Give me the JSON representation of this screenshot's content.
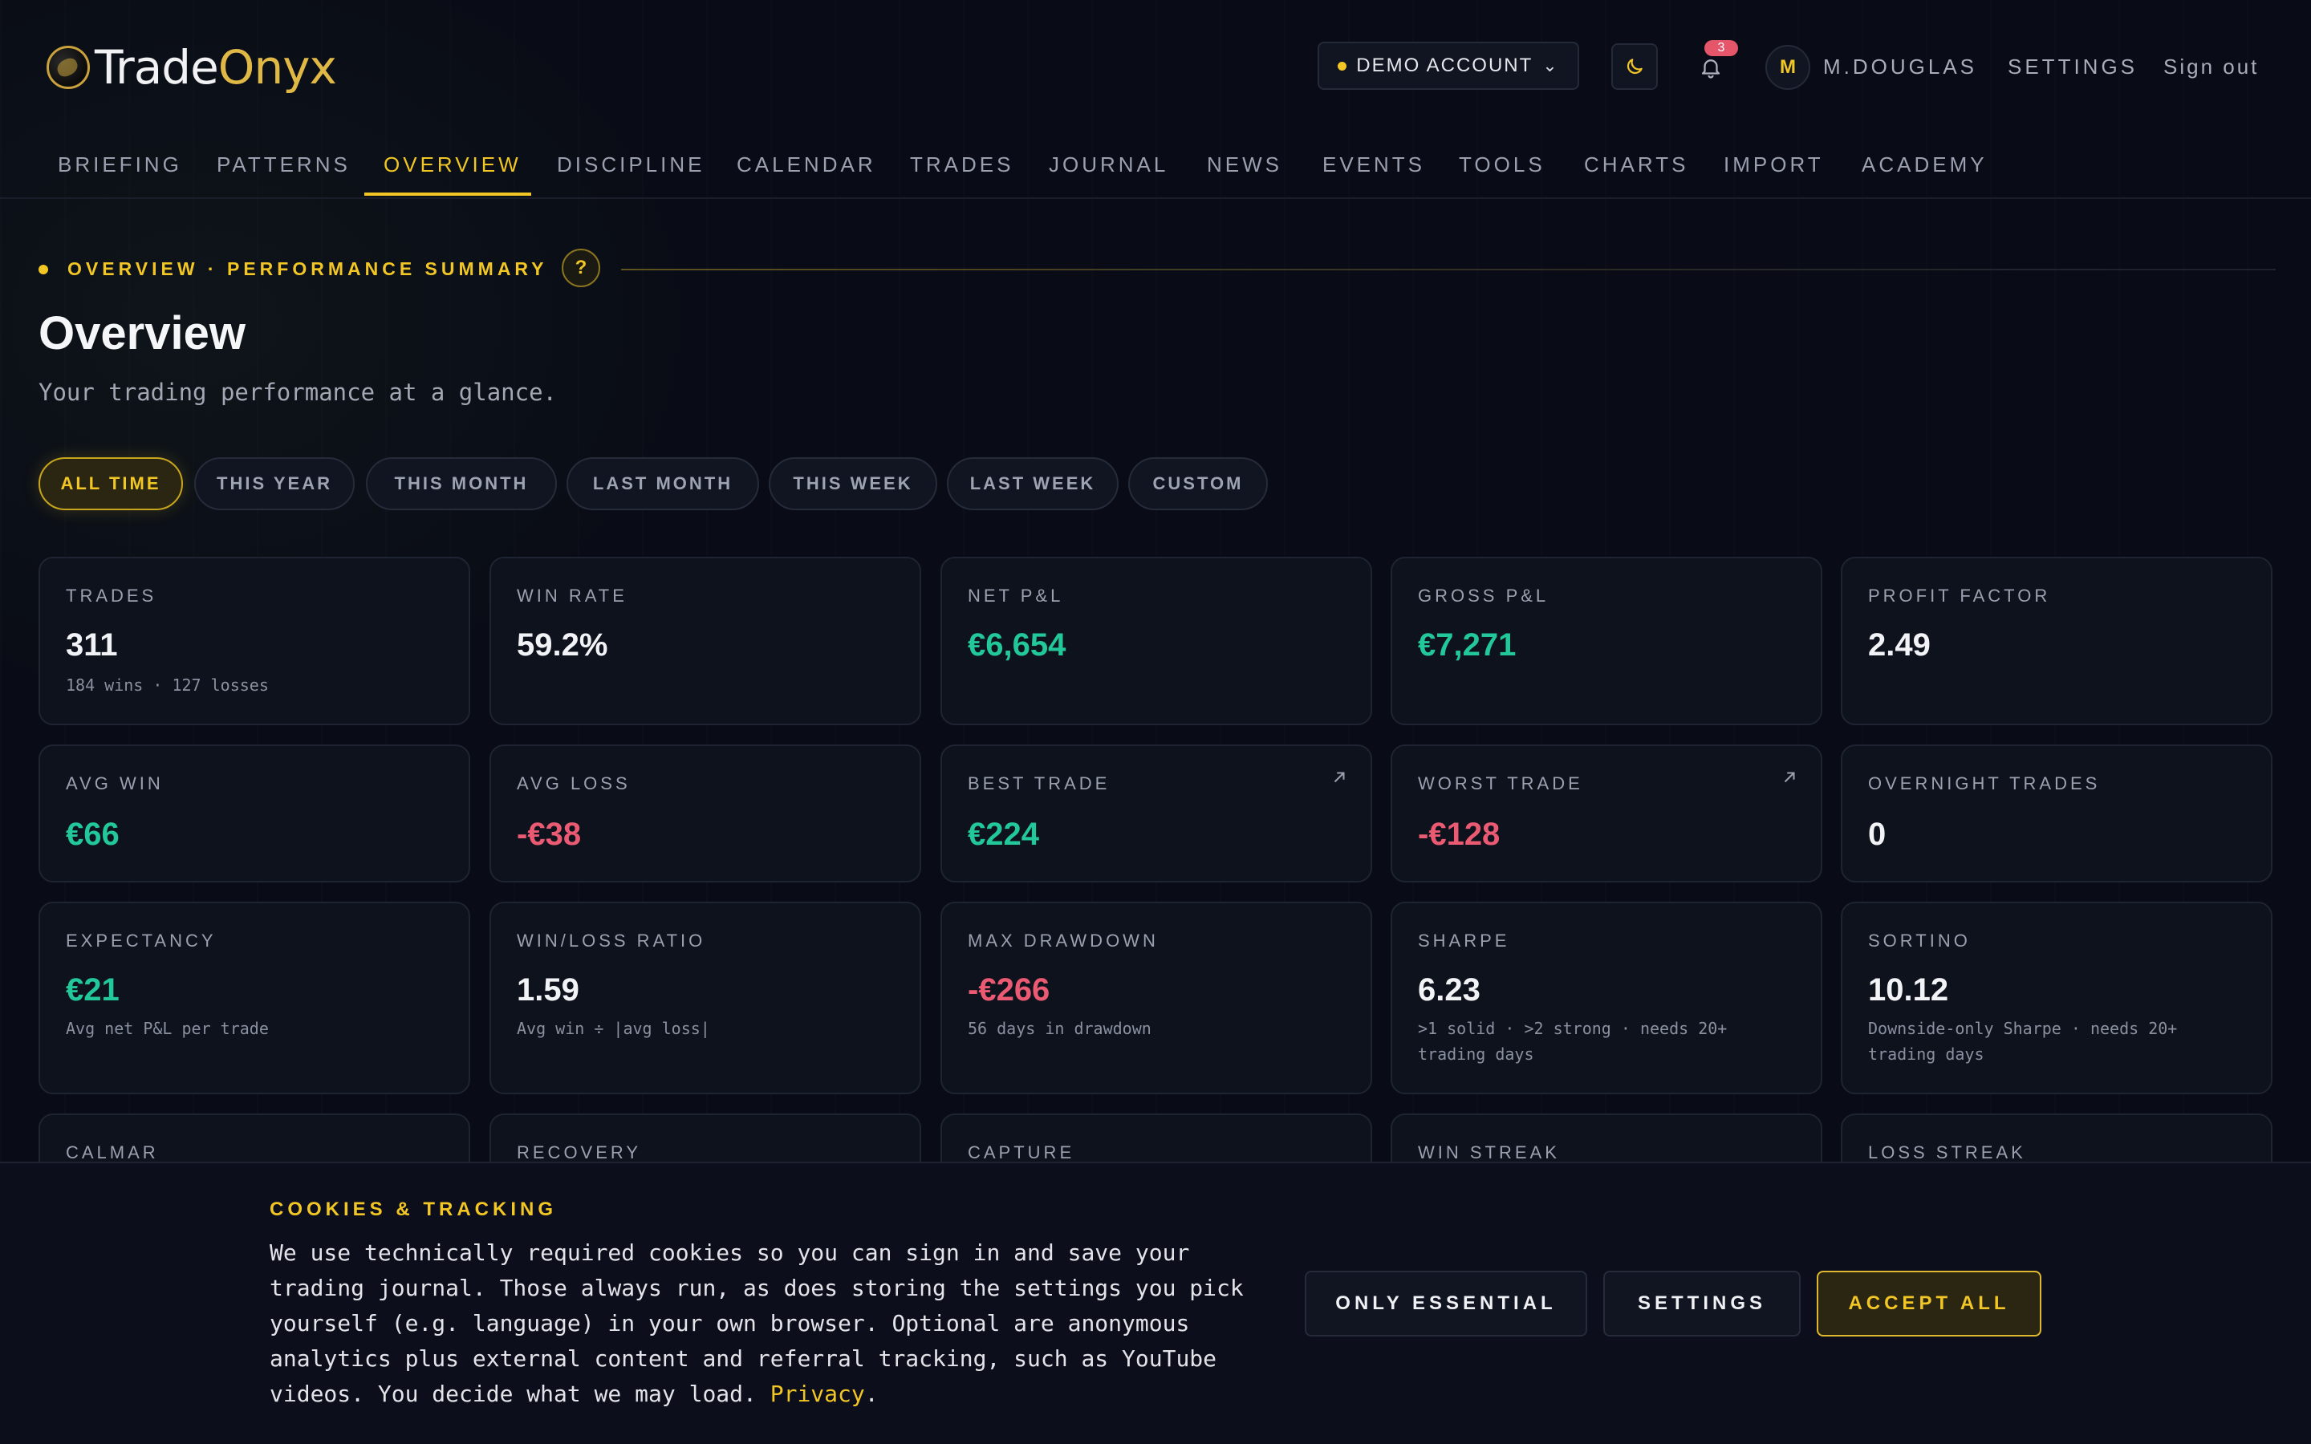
{
  "header": {
    "logo_part1": "Trade",
    "logo_part2": "Onyx",
    "account_label": "DEMO ACCOUNT",
    "notification_count": "3",
    "avatar_initial": "M",
    "username": "M.DOUGLAS",
    "settings_label": "SETTINGS",
    "signout_label": "Sign out"
  },
  "nav": {
    "items": [
      "BRIEFING",
      "PATTERNS",
      "OVERVIEW",
      "DISCIPLINE",
      "CALENDAR",
      "TRADES",
      "JOURNAL",
      "NEWS",
      "EVENTS",
      "TOOLS",
      "CHARTS",
      "IMPORT",
      "ACADEMY"
    ],
    "active": "OVERVIEW"
  },
  "section": {
    "eyebrow": "OVERVIEW · PERFORMANCE SUMMARY",
    "help": "?",
    "title": "Overview",
    "subtitle": "Your trading performance at a glance."
  },
  "filters": {
    "items": [
      "ALL TIME",
      "THIS YEAR",
      "THIS MONTH",
      "LAST MONTH",
      "THIS WEEK",
      "LAST WEEK",
      "CUSTOM"
    ],
    "active": "ALL TIME"
  },
  "cards": {
    "row1": [
      {
        "label": "TRADES",
        "value": "311",
        "note": "184 wins · 127 losses",
        "tone": "neutral"
      },
      {
        "label": "WIN RATE",
        "value": "59.2%",
        "note": "",
        "tone": "neutral"
      },
      {
        "label": "NET P&L",
        "value": "€6,654",
        "note": "",
        "tone": "pos"
      },
      {
        "label": "GROSS P&L",
        "value": "€7,271",
        "note": "",
        "tone": "pos"
      },
      {
        "label": "PROFIT FACTOR",
        "value": "2.49",
        "note": "",
        "tone": "neutral"
      }
    ],
    "row2": [
      {
        "label": "AVG WIN",
        "value": "€66",
        "tone": "pos"
      },
      {
        "label": "AVG LOSS",
        "value": "-€38",
        "tone": "neg"
      },
      {
        "label": "BEST TRADE",
        "value": "€224",
        "tone": "pos",
        "link_icon": "arrow-up-right-icon"
      },
      {
        "label": "WORST TRADE",
        "value": "-€128",
        "tone": "neg",
        "link_icon": "arrow-up-right-icon"
      },
      {
        "label": "OVERNIGHT TRADES",
        "value": "0",
        "tone": "neutral"
      }
    ],
    "row3": [
      {
        "label": "EXPECTANCY",
        "value": "€21",
        "note": "Avg net P&L per trade",
        "tone": "pos"
      },
      {
        "label": "WIN/LOSS RATIO",
        "value": "1.59",
        "note": "Avg win ÷ |avg loss|",
        "tone": "neutral"
      },
      {
        "label": "MAX DRAWDOWN",
        "value": "-€266",
        "note": "56 days in drawdown",
        "tone": "neg"
      },
      {
        "label": "SHARPE",
        "value": "6.23",
        "note": ">1 solid · >2 strong · needs 20+ trading days",
        "tone": "neutral"
      },
      {
        "label": "SORTINO",
        "value": "10.12",
        "note": "Downside-only Sharpe · needs 20+ trading days",
        "tone": "neutral"
      }
    ],
    "row4": [
      {
        "label": "CALMAR"
      },
      {
        "label": "RECOVERY"
      },
      {
        "label": "CAPTURE"
      },
      {
        "label": "WIN STREAK"
      },
      {
        "label": "LOSS STREAK"
      }
    ]
  },
  "cookie": {
    "title": "COOKIES & TRACKING",
    "text": "We use technically required cookies so you can sign in and save your trading journal. Those always run, as does storing the settings you pick yourself (e.g. language) in your own browser. Optional are anonymous analytics plus external content and referral tracking, such as YouTube videos. You decide what we may load.",
    "privacy_link": "Privacy",
    "period": ".",
    "btn_essential": "ONLY ESSENTIAL",
    "btn_settings": "SETTINGS",
    "btn_accept": "ACCEPT ALL"
  },
  "colors": {
    "accent": "#f2c624",
    "positive": "#22c79a",
    "negative": "#ea5a72",
    "background": "#090c16"
  }
}
